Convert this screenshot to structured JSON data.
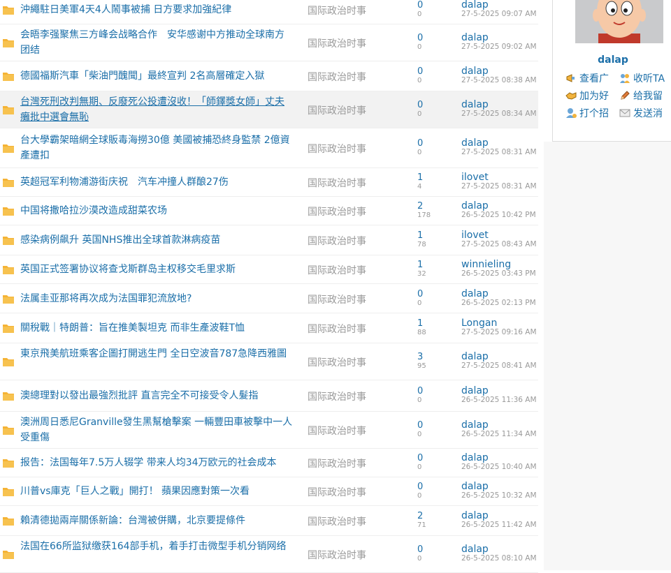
{
  "threads": [
    {
      "title": "沖繩駐日美軍4天4人鬧事被捕 日方要求加強紀律",
      "forum": "国际政治时事",
      "replies": "0",
      "views": "0",
      "last_user": "dalap",
      "last_time": "27-5-2025 09:07 AM"
    },
    {
      "title": "会晤李强聚焦三方峰会战略合作　安华感谢中方推动全球南方团结",
      "forum": "国际政治时事",
      "replies": "0",
      "views": "0",
      "last_user": "dalap",
      "last_time": "27-5-2025 09:02 AM"
    },
    {
      "title": "德國福斯汽車「柴油門醜聞」最終宣判 2名高層確定入獄",
      "forum": "国际政治时事",
      "replies": "0",
      "views": "0",
      "last_user": "dalap",
      "last_time": "27-5-2025 08:38 AM"
    },
    {
      "title": "台灣死刑改判無期、反廢死公投遭沒收！「師鐸獎女師」丈夫癱批中選會無恥",
      "forum": "国际政治时事",
      "replies": "0",
      "views": "0",
      "last_user": "dalap",
      "last_time": "27-5-2025 08:34 AM"
    },
    {
      "title": "台大學霸架暗網全球販毒海撈30億 美國被捕恐終身監禁 2億資產遭扣",
      "forum": "国际政治时事",
      "replies": "0",
      "views": "0",
      "last_user": "dalap",
      "last_time": "27-5-2025 08:31 AM"
    },
    {
      "title": "英超冠军利物浦游街庆祝　汽车冲撞人群酿27伤",
      "forum": "国际政治时事",
      "replies": "1",
      "views": "4",
      "last_user": "ilovet",
      "last_time": "27-5-2025 08:31 AM"
    },
    {
      "title": "中国将撒哈拉沙漠改造成甜菜农场",
      "forum": "国际政治时事",
      "replies": "2",
      "views": "178",
      "last_user": "dalap",
      "last_time": "26-5-2025 10:42 PM"
    },
    {
      "title": "感染病例飙升 英国NHS推出全球首款淋病疫苗",
      "forum": "国际政治时事",
      "replies": "1",
      "views": "78",
      "last_user": "ilovet",
      "last_time": "27-5-2025 08:43 AM"
    },
    {
      "title": "英国正式签署协议将查戈斯群岛主权移交毛里求斯",
      "forum": "国际政治时事",
      "replies": "1",
      "views": "32",
      "last_user": "winnieling",
      "last_time": "26-5-2025 03:43 PM"
    },
    {
      "title": "法属圭亚那将再次成为法国罪犯流放地?",
      "forum": "国际政治时事",
      "replies": "0",
      "views": "0",
      "last_user": "dalap",
      "last_time": "26-5-2025 02:13 PM"
    },
    {
      "title": "關稅戰｜特朗普：旨在推美製坦克 而非生產波鞋T恤",
      "forum": "国际政治时事",
      "replies": "1",
      "views": "88",
      "last_user": "Longan",
      "last_time": "27-5-2025 09:16 AM"
    },
    {
      "title": "東京飛美航班乘客企圖打開逃生門 全日空波音787急降西雅圖",
      "forum": "国际政治时事",
      "replies": "3",
      "views": "95",
      "last_user": "dalap",
      "last_time": "27-5-2025 08:41 AM"
    },
    {
      "title": "澳總理對以發出最強烈批評 直言完全不可接受令人髮指",
      "forum": "国际政治时事",
      "replies": "0",
      "views": "0",
      "last_user": "dalap",
      "last_time": "26-5-2025 11:36 AM"
    },
    {
      "title": "澳洲周日悉尼Granville發生黑幫槍擊案 一輛豐田車被擊中一人受重傷",
      "forum": "国际政治时事",
      "replies": "0",
      "views": "0",
      "last_user": "dalap",
      "last_time": "26-5-2025 11:34 AM"
    },
    {
      "title": "报告：法国每年7.5万人辍学 带来人均34万欧元的社会成本",
      "forum": "国际政治时事",
      "replies": "0",
      "views": "0",
      "last_user": "dalap",
      "last_time": "26-5-2025 10:40 AM"
    },
    {
      "title": "川普vs庫克「巨人之戰」開打！ 蘋果因應對策一次看",
      "forum": "国际政治时事",
      "replies": "0",
      "views": "0",
      "last_user": "dalap",
      "last_time": "26-5-2025 10:32 AM"
    },
    {
      "title": "賴清德拋兩岸關係新論：台灣被併購，北京要提條件",
      "forum": "国际政治时事",
      "replies": "2",
      "views": "71",
      "last_user": "dalap",
      "last_time": "26-5-2025 11:42 AM"
    },
    {
      "title": "法国在66所监狱缴获164部手机，着手打击微型手机分销网络",
      "forum": "国际政治时事",
      "replies": "0",
      "views": "0",
      "last_user": "dalap",
      "last_time": "26-5-2025 08:10 AM"
    }
  ],
  "profile": {
    "username": "dalap",
    "actions": [
      {
        "label": "查看广",
        "icon": "megaphone-icon"
      },
      {
        "label": "收听TA",
        "icon": "listen-users-icon"
      },
      {
        "label": "加为好",
        "icon": "handshake-icon"
      },
      {
        "label": "给我留",
        "icon": "pencil-icon"
      },
      {
        "label": "打个招",
        "icon": "greet-user-icon"
      },
      {
        "label": "发送消",
        "icon": "envelope-icon"
      }
    ]
  },
  "colors": {
    "link": "#1a6ea8",
    "muted": "#9a9a9a",
    "folder": "#f5b335",
    "highlight_row": "#f2f2f2"
  }
}
